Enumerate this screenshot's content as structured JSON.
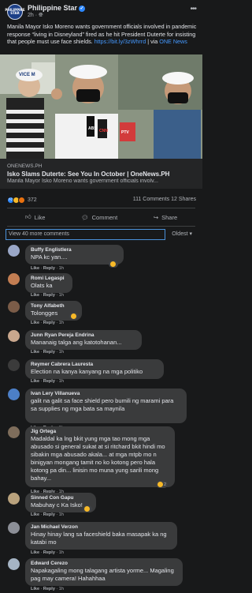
{
  "post": {
    "page_name": "Philippine Star",
    "avatar_text": "PHILIPPINE STAR",
    "time": "2h · ",
    "caption_text": "Manila Mayor Isko Moreno wants government officials involved in pandemic response “living in Disneyland” fired as he hit President Duterte for insisting that people must use face shields. ",
    "caption_link": "https://bit.ly/3zWhrrd",
    "caption_via": " | via ",
    "caption_via_link": "ONE News"
  },
  "preview": {
    "domain": "ONENEWS.PH",
    "title": "Isko Slams Duterte: See You In October | OneNews.PH",
    "description": "Manila Mayor Isko Moreno wants government officials involv..."
  },
  "stats": {
    "reaction_count": "372",
    "comments_shares": "111 Comments  12 Shares"
  },
  "actions": {
    "like": "Like",
    "comment": "Comment",
    "share": "Share"
  },
  "comments_bar": {
    "view_more": "View 40 more comments",
    "sort": "Oldest ▾"
  },
  "comment_meta": {
    "like": "Like",
    "reply": "Reply",
    "time": "1h"
  },
  "comments": [
    {
      "name": "Buffy Englistlera",
      "text": "NPA kc yan....",
      "reaction": ""
    },
    {
      "name": "Romi Legaspi",
      "text": "Olats ka",
      "reaction": ""
    },
    {
      "name": "Tony Alfabeth",
      "text": "Tolongges",
      "reaction": ""
    },
    {
      "name": "Junn Ryan Pereja Endrina",
      "text": "Mananaig talga ang katotohanan...",
      "reaction": ""
    },
    {
      "name": "Reymer Cabrera Lauresta",
      "text": "Election na kanya kanyang na mga politiko",
      "reaction": ""
    },
    {
      "name": "Ivan Lery Villanueva",
      "text": "galit na galit sa face shield pero bumili ng marami para sa supplies ng mga bata sa maynila",
      "reaction": ""
    },
    {
      "name": "Jig Ortega",
      "text": "Madaldal ka lng bkit yung mga tao mong mga abusado si general sukat at si ritchard bkit hindi mo sibakin mga abusado akala... at mga mtpb mo n binigyan mongang tamit no ko kotong pero hala kotong pa din... linisin mo muna yung sarili mong bahay...",
      "reaction": "2"
    },
    {
      "name": "Sinned Con Gapu",
      "text": "Mabuhay c Ka Isko!",
      "reaction": ""
    },
    {
      "name": "Jan Michael Verzon",
      "text": "Hinay hinay lang sa faceshield baka masapak ka ng katabi mo",
      "reaction": ""
    },
    {
      "name": "Edward Cerezo",
      "text": "Napakagaling mong talagang artista yorme... Magaling pag may camera! Hahahhaa",
      "reaction": ""
    }
  ],
  "photo_signs": {
    "vice": "VICE M",
    "abs": "ABS",
    "cnn": "CNN",
    "ptv": "PTV"
  },
  "colors": {
    "background": "#18191a",
    "bubble": "#3a3b3c",
    "link": "#4599ff",
    "text": "#e4e6eb",
    "muted": "#b0b3b8"
  }
}
